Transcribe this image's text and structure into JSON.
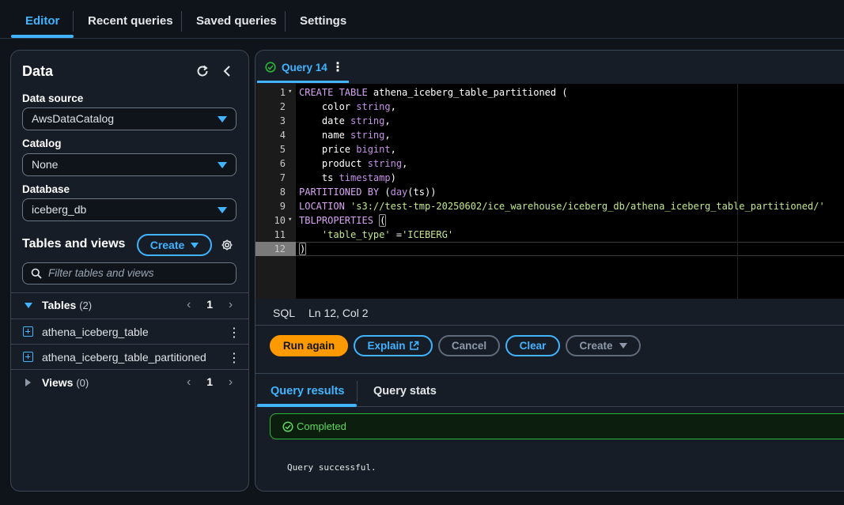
{
  "top_tabs": [
    {
      "label": "Editor",
      "active": true
    },
    {
      "label": "Recent queries",
      "active": false
    },
    {
      "label": "Saved queries",
      "active": false
    },
    {
      "label": "Settings",
      "active": false
    }
  ],
  "data_panel": {
    "title": "Data",
    "data_source": {
      "label": "Data source",
      "value": "AwsDataCatalog"
    },
    "catalog": {
      "label": "Catalog",
      "value": "None"
    },
    "database": {
      "label": "Database",
      "value": "iceberg_db"
    },
    "tables_and_views": {
      "title": "Tables and views",
      "create_label": "Create",
      "filter_placeholder": "Filter tables and views"
    },
    "tables": {
      "label": "Tables",
      "count": "(2)",
      "page": "1",
      "items": [
        "athena_iceberg_table",
        "athena_iceberg_table_partitioned"
      ]
    },
    "views": {
      "label": "Views",
      "count": "(0)",
      "page": "1"
    }
  },
  "query_tab": {
    "label": "Query 14"
  },
  "editor": {
    "line_numbers": [
      "1",
      "2",
      "3",
      "4",
      "5",
      "6",
      "7",
      "8",
      "9",
      "10",
      "11",
      "12"
    ],
    "active_line": 12
  },
  "status": {
    "language": "SQL",
    "position": "Ln 12, Col 2"
  },
  "actions": {
    "run_again": "Run again",
    "explain": "Explain",
    "cancel": "Cancel",
    "clear": "Clear",
    "create": "Create"
  },
  "results_tabs": [
    {
      "label": "Query results",
      "active": true
    },
    {
      "label": "Query stats",
      "active": false
    }
  ],
  "result": {
    "status": "Completed",
    "message": "Query successful."
  },
  "colors": {
    "accent": "#42b4ff",
    "primary_button": "#ff9900",
    "success": "#2bb534"
  }
}
